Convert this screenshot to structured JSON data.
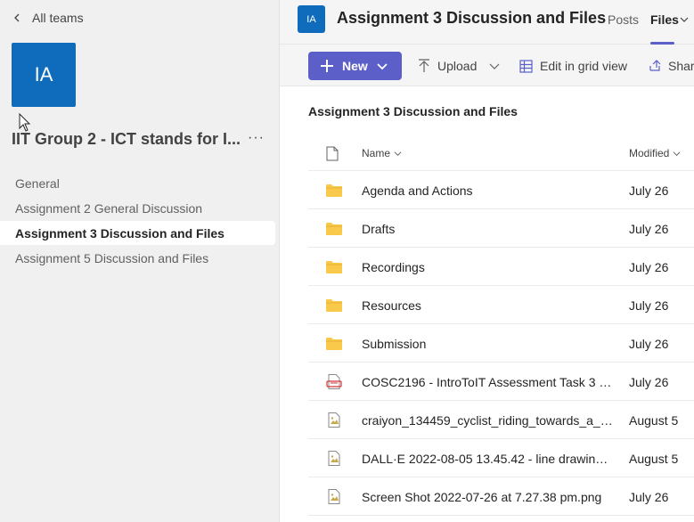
{
  "nav": {
    "back_label": "All teams"
  },
  "team": {
    "avatar_initials": "IA",
    "avatar_color": "#0f6cbd",
    "name": "IIT Group 2 - ICT stands for I...",
    "more_icon": "more-horizontal-icon"
  },
  "channels": [
    {
      "label": "General",
      "active": false
    },
    {
      "label": "Assignment 2 General Discussion",
      "active": false
    },
    {
      "label": "Assignment 3 Discussion and Files",
      "active": true
    },
    {
      "label": "Assignment 5 Discussion and Files",
      "active": false
    }
  ],
  "header": {
    "avatar_initials": "IA",
    "title": "Assignment 3 Discussion and Files",
    "tabs": [
      {
        "label": "Posts",
        "active": false
      },
      {
        "label": "Files",
        "active": true
      }
    ]
  },
  "toolbar": {
    "new_label": "New",
    "upload_label": "Upload",
    "grid_label": "Edit in grid view",
    "share_label": "Shar",
    "accent": "#5b5fc7"
  },
  "library": {
    "title": "Assignment 3 Discussion and Files",
    "columns": {
      "name": "Name",
      "modified": "Modified"
    },
    "files": [
      {
        "name": "Agenda and Actions",
        "modified": "July 26",
        "type": "folder"
      },
      {
        "name": "Drafts",
        "modified": "July 26",
        "type": "folder"
      },
      {
        "name": "Recordings",
        "modified": "July 26",
        "type": "folder"
      },
      {
        "name": "Resources",
        "modified": "July 26",
        "type": "folder"
      },
      {
        "name": "Submission",
        "modified": "July 26",
        "type": "folder"
      },
      {
        "name": "COSC2196 - IntroToIT Assessment Task 3 - ...",
        "modified": "July 26",
        "type": "pdf"
      },
      {
        "name": "craiyon_134459_cyclist_riding_towards_a_ca...",
        "modified": "August 5",
        "type": "image"
      },
      {
        "name": "DALL·E 2022-08-05 13.45.42 - line drawing ...",
        "modified": "August 5",
        "type": "image"
      },
      {
        "name": "Screen Shot 2022-07-26 at 7.27.38 pm.png",
        "modified": "July 26",
        "type": "image"
      }
    ]
  }
}
